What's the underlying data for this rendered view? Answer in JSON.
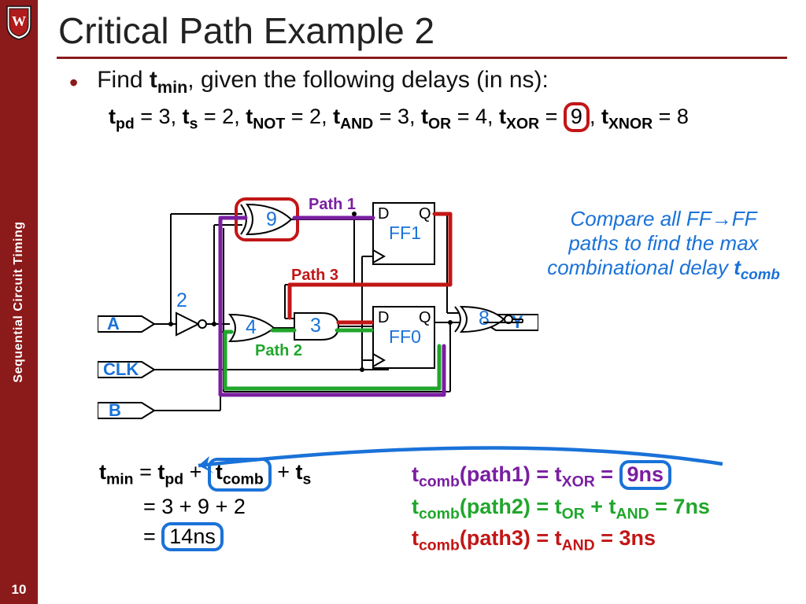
{
  "slide_number": "10",
  "sidebar_title": "Sequential Circuit Timing",
  "title": "Critical Path Example 2",
  "prompt_pre": "Find ",
  "prompt_var": "t",
  "prompt_sub": "min",
  "prompt_post": ", given the following delays (in ns):",
  "delays": {
    "t_pd": "3",
    "t_s": "2",
    "t_NOT": "2",
    "t_AND": "3",
    "t_OR": "4",
    "t_XOR": "9",
    "t_XNOR": "8"
  },
  "hint_l1": "Compare all FF→FF",
  "hint_l2": "paths to find the max",
  "hint_l3_pre": "combinational delay ",
  "hint_l3_var": "t",
  "hint_l3_sub": "comb",
  "pathlabels": {
    "p1": "Path 1",
    "p2": "Path 2",
    "p3": "Path 3"
  },
  "signals": {
    "A": "A",
    "CLK": "CLK",
    "B": "B",
    "Y": "Y"
  },
  "ff": {
    "D": "D",
    "Q": "Q",
    "ff0": "FF0",
    "ff1": "FF1"
  },
  "gate_nums": {
    "xor": "9",
    "not": "2",
    "or": "4",
    "and": "3",
    "xnor": "8"
  },
  "eq": {
    "l1_pre": "t",
    "l1_sub": "min",
    "l1_mid1": " = ",
    "l1_t1": "t",
    "l1_t1s": "pd",
    "l1_mid2": " + ",
    "l1_t2": "t",
    "l1_t2s": "comb",
    "l1_mid3": " + ",
    "l1_t3": "t",
    "l1_t3s": "s",
    "l2": "= 3 + 9 + 2",
    "l3_pre": "= ",
    "l3_val": "14ns"
  },
  "paths": {
    "p1_lhs": "t",
    "p1_sub": "comb",
    "p1_arg": "(path1) = t",
    "p1_rsub": "XOR",
    "p1_eq": " = ",
    "p1_val": "9ns",
    "p2_lhs": "t",
    "p2_sub": "comb",
    "p2_arg": "(path2) = t",
    "p2_or": "OR",
    "p2_plus": " + t",
    "p2_and": "AND",
    "p2_eq": " = 7ns",
    "p3_lhs": "t",
    "p3_sub": "comb",
    "p3_arg": "(path3) = t",
    "p3_and": "AND",
    "p3_eq": " = 3ns"
  },
  "chart_data": {
    "type": "diagram",
    "title": "Critical Path Example 2",
    "inputs": [
      "A",
      "CLK",
      "B"
    ],
    "outputs": [
      "Y"
    ],
    "gates": [
      {
        "name": "NOT",
        "delay_ns": 2,
        "inputs": [
          "A"
        ],
        "output": "n1"
      },
      {
        "name": "XOR",
        "delay_ns": 9,
        "inputs": [
          "n1",
          "FF0.Q"
        ],
        "output": "x1"
      },
      {
        "name": "OR",
        "delay_ns": 4,
        "inputs": [
          "n1",
          "B"
        ],
        "output": "o1"
      },
      {
        "name": "AND",
        "delay_ns": 3,
        "inputs": [
          "o1",
          "FF1.Q"
        ],
        "output": "a1"
      },
      {
        "name": "XNOR",
        "delay_ns": 8,
        "inputs": [
          "FF1.Q",
          "FF0.Q"
        ],
        "output": "Y"
      }
    ],
    "flipflops": [
      {
        "name": "FF1",
        "D": "x1",
        "CLK": "CLK",
        "Q": "FF1.Q"
      },
      {
        "name": "FF0",
        "D": "a1",
        "CLK": "CLK",
        "Q": "FF0.Q"
      }
    ],
    "ff_params": {
      "t_pd": 3,
      "t_s": 2
    },
    "paths": [
      {
        "name": "Path 1",
        "color": "purple",
        "gates": [
          "XOR"
        ],
        "t_comb_ns": 9
      },
      {
        "name": "Path 2",
        "color": "green",
        "gates": [
          "OR",
          "AND"
        ],
        "t_comb_ns": 7
      },
      {
        "name": "Path 3",
        "color": "red",
        "gates": [
          "AND"
        ],
        "t_comb_ns": 3
      }
    ],
    "t_comb_max_ns": 9,
    "t_min_ns": 14
  }
}
